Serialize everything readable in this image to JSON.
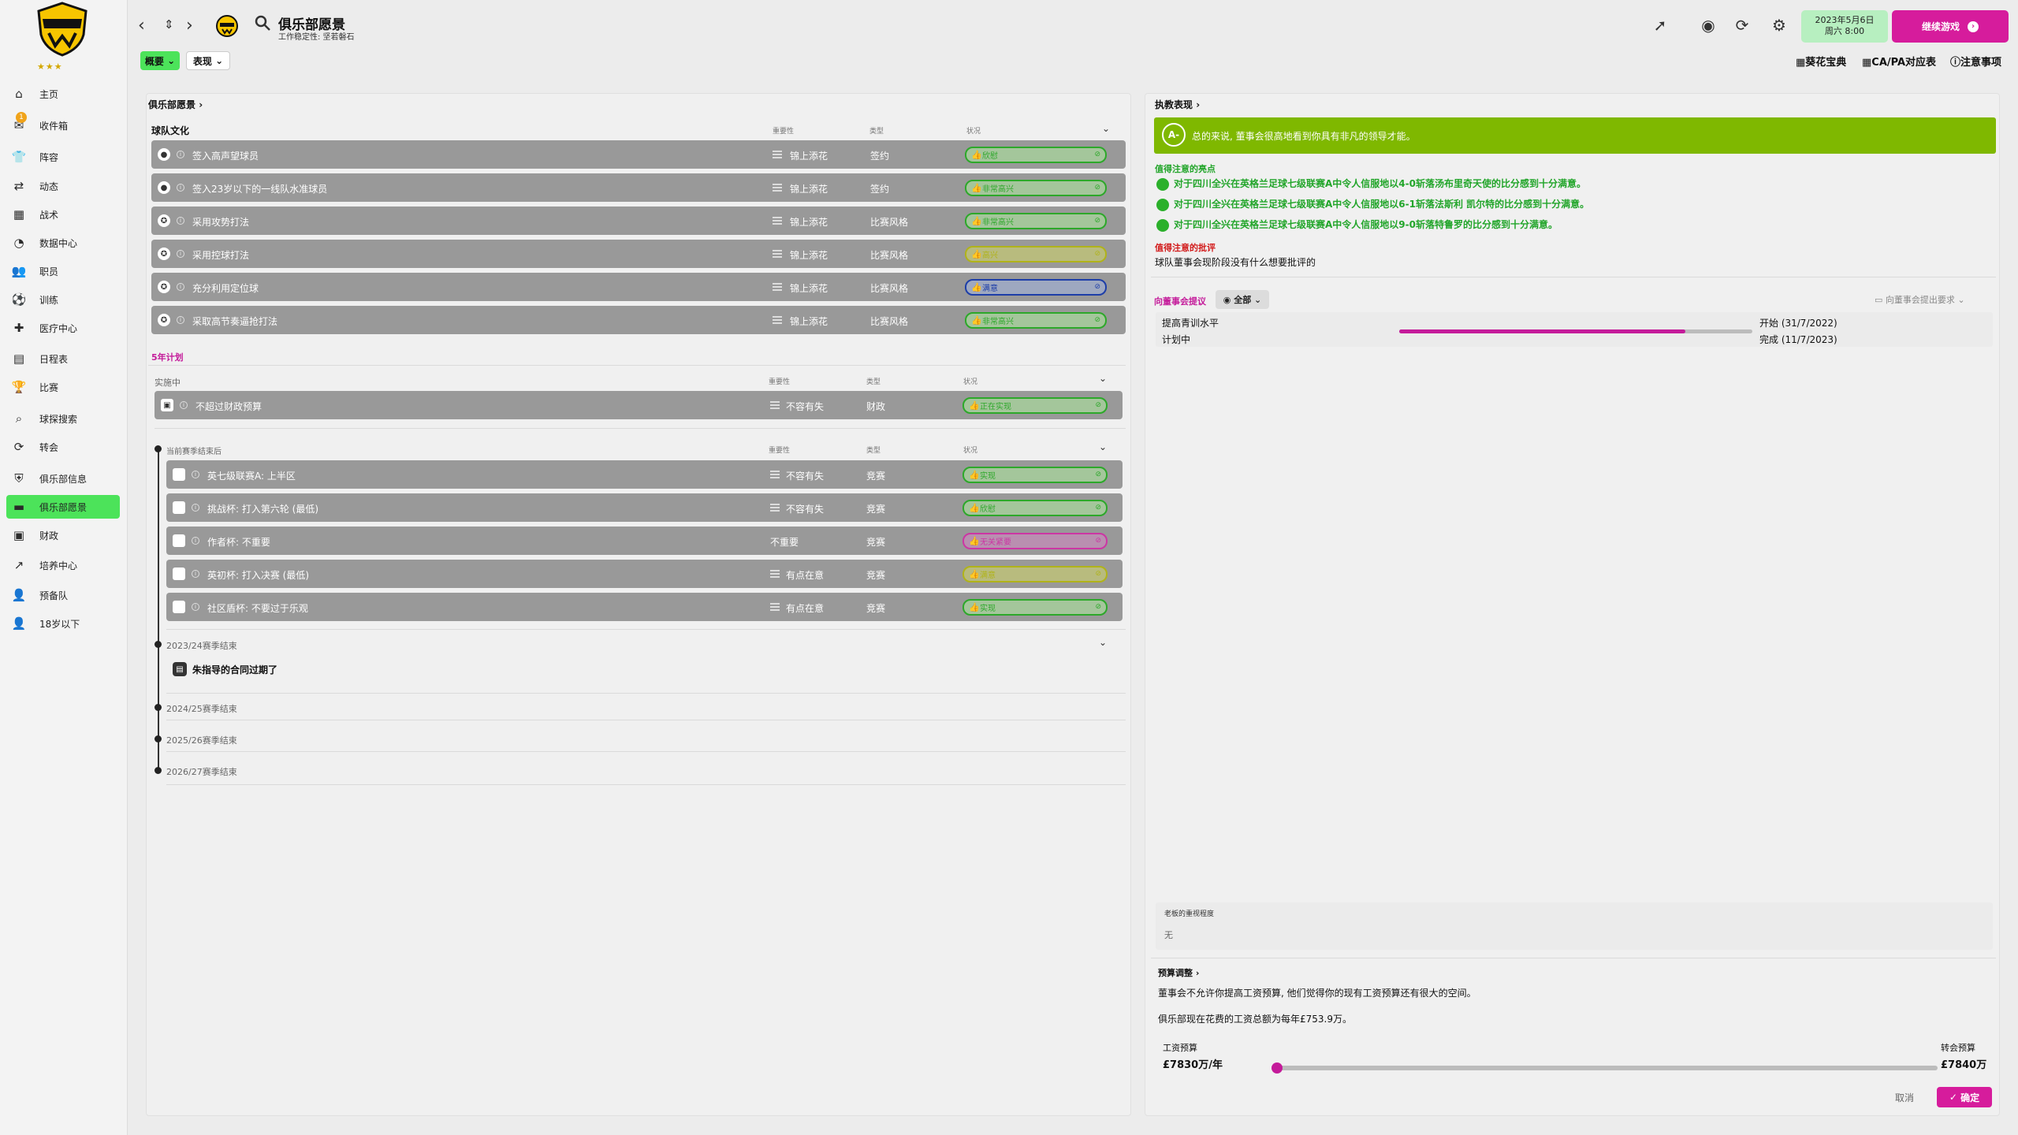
{
  "sidebar": {
    "stars": "★★★",
    "inbox_badge": "1",
    "items": [
      {
        "label": "主页",
        "icon": "home-icon",
        "glyph": "⌂"
      },
      {
        "label": "收件箱",
        "icon": "inbox-icon",
        "glyph": "✉"
      },
      {
        "label": "阵容",
        "icon": "squad-icon",
        "glyph": "👕"
      },
      {
        "label": "动态",
        "icon": "dynamics-icon",
        "glyph": "⇄"
      },
      {
        "label": "战术",
        "icon": "tactics-icon",
        "glyph": "▦"
      },
      {
        "label": "数据中心",
        "icon": "data-hub-icon",
        "glyph": "◔"
      },
      {
        "label": "职员",
        "icon": "staff-icon",
        "glyph": "👥"
      },
      {
        "label": "训练",
        "icon": "training-icon",
        "glyph": "⚽"
      },
      {
        "label": "医疗中心",
        "icon": "medical-icon",
        "glyph": "✚"
      },
      {
        "label": "日程表",
        "icon": "schedule-icon",
        "glyph": "▤"
      },
      {
        "label": "比赛",
        "icon": "trophy-icon",
        "glyph": "🏆"
      },
      {
        "label": "球探搜索",
        "icon": "scouting-icon",
        "glyph": "⌕"
      },
      {
        "label": "转会",
        "icon": "transfers-icon",
        "glyph": "⟳"
      },
      {
        "label": "俱乐部信息",
        "icon": "club-info-icon",
        "glyph": "⛨"
      },
      {
        "label": "俱乐部愿景",
        "icon": "club-vision-icon",
        "glyph": "▬"
      },
      {
        "label": "财政",
        "icon": "finances-icon",
        "glyph": "▣"
      },
      {
        "label": "培养中心",
        "icon": "development-icon",
        "glyph": "↗"
      },
      {
        "label": "预备队",
        "icon": "reserves-icon",
        "glyph": "👤"
      },
      {
        "label": "18岁以下",
        "icon": "u18-icon",
        "glyph": "👤"
      }
    ]
  },
  "header": {
    "title": "俱乐部愿景",
    "subtitle": "工作稳定性: 坚若磐石",
    "date": "2023年5月6日",
    "time": "周六 8:00",
    "continue": "继续游戏",
    "subtab_overview": "概要",
    "subtab_performance": "表现",
    "link_handbook": "葵花宝典",
    "link_capa": "CA/PA对应表",
    "link_notes": "注意事项"
  },
  "vision": {
    "title": "俱乐部愿景",
    "culture_title": "球队文化",
    "col_importance": "重要性",
    "col_type": "类型",
    "col_status": "状况",
    "culture_rows": [
      {
        "label": "签入高声望球员",
        "importance": "锦上添花",
        "type": "签约",
        "status": "欣慰",
        "status_color": "green",
        "icon": "person-icon",
        "glyph": "●"
      },
      {
        "label": "签入23岁以下的一线队水准球员",
        "importance": "锦上添花",
        "type": "签约",
        "status": "非常高兴",
        "status_color": "green",
        "icon": "person-icon",
        "glyph": "●"
      },
      {
        "label": "采用攻势打法",
        "importance": "锦上添花",
        "type": "比赛风格",
        "status": "非常高兴",
        "status_color": "green",
        "icon": "football-icon",
        "glyph": "✪"
      },
      {
        "label": "采用控球打法",
        "importance": "锦上添花",
        "type": "比赛风格",
        "status": "高兴",
        "status_color": "yellow",
        "icon": "football-icon",
        "glyph": "✪"
      },
      {
        "label": "充分利用定位球",
        "importance": "锦上添花",
        "type": "比赛风格",
        "status": "满意",
        "status_color": "blue",
        "icon": "football-icon",
        "glyph": "✪"
      },
      {
        "label": "采取高节奏逼抢打法",
        "importance": "锦上添花",
        "type": "比赛风格",
        "status": "非常高兴",
        "status_color": "green",
        "icon": "football-icon",
        "glyph": "✪"
      }
    ],
    "plan_title": "5年计划",
    "in_progress_title": "实施中",
    "plan_rows": [
      {
        "label": "不超过财政预算",
        "importance": "不容有失",
        "type": "财政",
        "status": "正在实现",
        "status_color": "green",
        "icon": "finance-icon",
        "glyph": "▣"
      }
    ],
    "season_end_title": "当前赛季结束后",
    "season_rows": [
      {
        "label": "英七级联赛A: 上半区",
        "importance": "不容有失",
        "type": "竞赛",
        "status": "实现",
        "status_color": "green",
        "icon": "league-crest-icon",
        "imp_icon": true
      },
      {
        "label": "挑战杯: 打入第六轮 (最低)",
        "importance": "不容有失",
        "type": "竞赛",
        "status": "欣慰",
        "status_color": "green",
        "icon": "cup-crest-icon",
        "imp_icon": true
      },
      {
        "label": "作者杯: 不重要",
        "importance": "不重要",
        "type": "竞赛",
        "status": "无关紧要",
        "status_color": "pink",
        "icon": "cup-crest-icon",
        "imp_icon": false
      },
      {
        "label": "英初杯: 打入决赛 (最低)",
        "importance": "有点在意",
        "type": "竞赛",
        "status": "满意",
        "status_color": "yellow",
        "icon": "cup-crest-icon",
        "imp_icon": true
      },
      {
        "label": "社区盾杯: 不要过于乐观",
        "importance": "有点在意",
        "type": "竞赛",
        "status": "实现",
        "status_color": "green",
        "icon": "shield-crest-icon",
        "imp_icon": true
      }
    ],
    "season_2023": "2023/24赛季结束",
    "contract_note": "朱指导的合同过期了",
    "season_2024": "2024/25赛季结束",
    "season_2025": "2025/26赛季结束",
    "season_2026": "2026/27赛季结束"
  },
  "performance": {
    "title": "执教表现",
    "rating": "A-",
    "summary": "总的来说, 董事会很高地看到你具有非凡的领导才能。",
    "highlights_title": "值得注意的亮点",
    "highlights": [
      "对于四川全兴在英格兰足球七级联赛A中令人信服地以4-0斩落汤布里奇天使的比分感到十分满意。",
      "对于四川全兴在英格兰足球七级联赛A中令人信服地以6-1斩落法斯利 凯尔特的比分感到十分满意。",
      "对于四川全兴在英格兰足球七级联赛A中令人信服地以9-0斩落特鲁罗的比分感到十分满意。"
    ],
    "criticism_title": "值得注意的批评",
    "criticism_text": "球队董事会现阶段没有什么想要批评的"
  },
  "board_requests": {
    "title": "向董事会提议",
    "filter": "全部",
    "make_request": "向董事会提出要求",
    "request_name": "提高青训水平",
    "request_state": "计划中",
    "start_label": "开始 (31/7/2022)",
    "end_label": "完成 (11/7/2023)",
    "progress": 0.81,
    "boss_mood_label": "老板的重视程度",
    "boss_mood_value": "无"
  },
  "budget": {
    "title": "预算调整",
    "line1": "董事会不允许你提高工资预算, 他们觉得你的现有工资预算还有很大的空间。",
    "line2": "俱乐部现在花费的工资总额为每年£753.9万。",
    "wage_label": "工资预算",
    "wage_value": "£7830万/年",
    "transfer_label": "转会预算",
    "transfer_value": "£7840万",
    "cancel": "取消",
    "confirm": "确定"
  },
  "colors": {
    "accent_green": "#4ce35a",
    "accent_pink": "#d61c9c",
    "rating_green": "#7fb800"
  }
}
